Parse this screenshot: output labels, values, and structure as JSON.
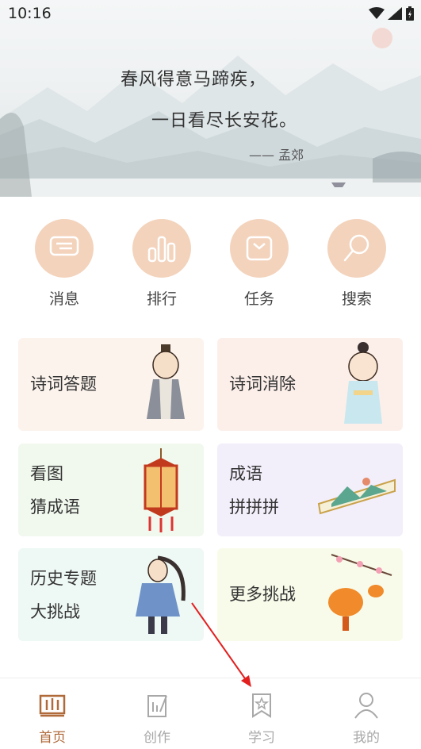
{
  "status_bar": {
    "time": "10:16"
  },
  "banner": {
    "poem_line1": "春风得意马蹄疾，",
    "poem_line2": "一日看尽长安花。",
    "author": "—— 孟郊"
  },
  "quick_actions": [
    {
      "label": "消息",
      "icon": "message-icon"
    },
    {
      "label": "排行",
      "icon": "ranking-icon"
    },
    {
      "label": "任务",
      "icon": "task-icon"
    },
    {
      "label": "搜索",
      "icon": "search-icon"
    }
  ],
  "cards": [
    {
      "lines": [
        "诗词答题"
      ],
      "bg": "#fbf3ec"
    },
    {
      "lines": [
        "诗词消除"
      ],
      "bg": "#fcefea"
    },
    {
      "lines": [
        "看图",
        "猜成语"
      ],
      "bg": "#f1f9ee"
    },
    {
      "lines": [
        "成语",
        "拼拼拼"
      ],
      "bg": "#f2eefa"
    },
    {
      "lines": [
        "历史专题",
        "大挑战"
      ],
      "bg": "#eef8f4"
    },
    {
      "lines": [
        "更多挑战"
      ],
      "bg": "#f9fbea"
    }
  ],
  "nav": [
    {
      "label": "首页",
      "icon": "home-book-icon",
      "active": true
    },
    {
      "label": "创作",
      "icon": "create-icon",
      "active": false
    },
    {
      "label": "学习",
      "icon": "study-bookmark-icon",
      "active": false
    },
    {
      "label": "我的",
      "icon": "profile-icon",
      "active": false
    }
  ],
  "colors": {
    "accent": "#b06a3a",
    "icon_circle": "#f3d3bc",
    "nav_inactive": "#a8a8a8"
  }
}
